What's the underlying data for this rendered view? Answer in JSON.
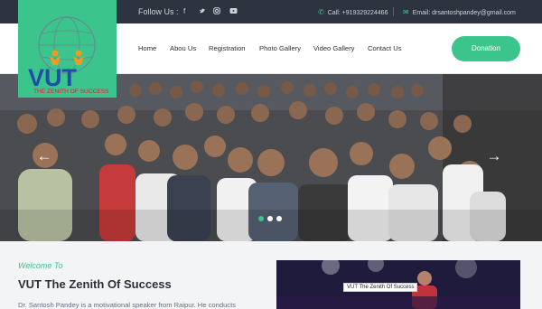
{
  "topbar": {
    "follow_label": "Follow Us :",
    "social_icons": [
      "facebook-icon",
      "twitter-icon",
      "instagram-icon",
      "youtube-icon"
    ],
    "phone": "Call: +919329224466",
    "email": "Email:  drsantoshpandey@gmail.com"
  },
  "logo": {
    "letters": "VUT",
    "tagline": "THE ZENITH OF SUCCESS"
  },
  "nav": {
    "items": [
      "Home",
      "Abou Us",
      "Registration",
      "Photo Gallery",
      "Video Gallery",
      "Contact Us"
    ],
    "donate_label": "Donation"
  },
  "hero": {
    "prev_glyph": "←",
    "next_glyph": "→",
    "slide_count": 3,
    "active_slide": 1
  },
  "about": {
    "welcome": "Welcome To",
    "title": "VUT The Zenith Of Success",
    "text": "Dr. Santosh Pandey is a motivational speaker from Raipur. He conducts"
  },
  "video": {
    "title": "VUT The Zenith Of Success"
  },
  "colors": {
    "accent": "#3cc48d",
    "topbar": "#2e3340",
    "logo_red": "#d8232a"
  }
}
